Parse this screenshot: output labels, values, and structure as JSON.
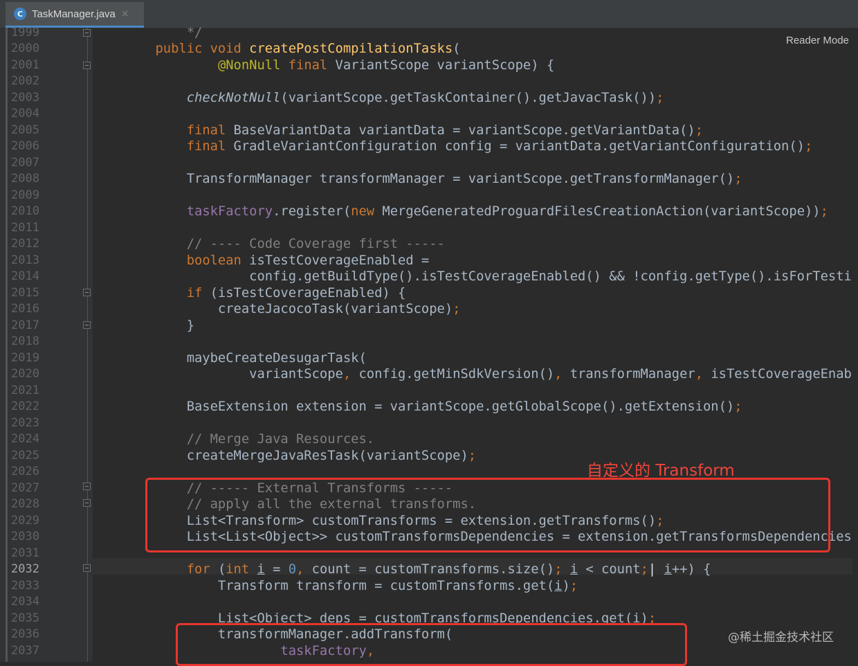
{
  "tab": {
    "filename": "TaskManager.java",
    "file_icon": "java-class-icon",
    "close_glyph": "×"
  },
  "reader_mode": "Reader Mode",
  "current_line": "2032",
  "annotation_label": "自定义的 Transform",
  "watermark": "@稀土掘金技术社区",
  "line_numbers": [
    "1999",
    "2000",
    "2001",
    "2002",
    "2003",
    "2004",
    "2005",
    "2006",
    "2007",
    "2008",
    "2009",
    "2010",
    "2011",
    "2012",
    "2013",
    "2014",
    "2015",
    "2016",
    "2017",
    "2018",
    "2019",
    "2020",
    "2021",
    "2022",
    "2023",
    "2024",
    "2025",
    "2026",
    "2027",
    "2028",
    "2029",
    "2030",
    "2031",
    "2032",
    "2033",
    "2034",
    "2035",
    "2036",
    "2037"
  ],
  "code": {
    "l1999": "    */",
    "l2000": [
      {
        "c": "kw",
        "t": "public void "
      },
      {
        "c": "fn",
        "t": "createPostCompilationTasks"
      },
      {
        "c": "",
        "t": "("
      }
    ],
    "l2001": [
      {
        "c": "",
        "t": "        "
      },
      {
        "c": "an",
        "t": "@NonNull "
      },
      {
        "c": "kw",
        "t": "final "
      },
      {
        "c": "",
        "t": "VariantScope variantScope) {"
      }
    ],
    "l2003": [
      {
        "c": "",
        "t": "    "
      },
      {
        "c": "it",
        "t": "checkNotNull"
      },
      {
        "c": "",
        "t": "(variantScope.getTaskContainer().getJavacTask())"
      },
      {
        "c": "kw",
        "t": ";"
      }
    ],
    "l2005": [
      {
        "c": "",
        "t": "    "
      },
      {
        "c": "kw",
        "t": "final "
      },
      {
        "c": "",
        "t": "BaseVariantData variantData = variantScope.getVariantData()"
      },
      {
        "c": "kw",
        "t": ";"
      }
    ],
    "l2006": [
      {
        "c": "",
        "t": "    "
      },
      {
        "c": "kw",
        "t": "final "
      },
      {
        "c": "",
        "t": "GradleVariantConfiguration config = variantData.getVariantConfiguration()"
      },
      {
        "c": "kw",
        "t": ";"
      }
    ],
    "l2008": [
      {
        "c": "",
        "t": "    TransformManager transformManager = variantScope.getTransformManager()"
      },
      {
        "c": "kw",
        "t": ";"
      }
    ],
    "l2010": [
      {
        "c": "",
        "t": "    "
      },
      {
        "c": "fi",
        "t": "taskFactory"
      },
      {
        "c": "",
        "t": ".register("
      },
      {
        "c": "kw",
        "t": "new "
      },
      {
        "c": "",
        "t": "MergeGeneratedProguardFilesCreationAction(variantScope))"
      },
      {
        "c": "kw",
        "t": ";"
      }
    ],
    "l2012": [
      {
        "c": "",
        "t": "    "
      },
      {
        "c": "cm",
        "t": "// ---- Code Coverage first -----"
      }
    ],
    "l2013": [
      {
        "c": "",
        "t": "    "
      },
      {
        "c": "kw",
        "t": "boolean "
      },
      {
        "c": "",
        "t": "isTestCoverageEnabled ="
      }
    ],
    "l2014": [
      {
        "c": "",
        "t": "            config.getBuildType().isTestCoverageEnabled() && !config.getType().isForTesting()"
      },
      {
        "c": "kw",
        "t": ";"
      }
    ],
    "l2015": [
      {
        "c": "",
        "t": "    "
      },
      {
        "c": "kw",
        "t": "if "
      },
      {
        "c": "",
        "t": "(isTestCoverageEnabled) {"
      }
    ],
    "l2016": [
      {
        "c": "",
        "t": "        createJacocoTask(variantScope)"
      },
      {
        "c": "kw",
        "t": ";"
      }
    ],
    "l2017": [
      {
        "c": "",
        "t": "    }"
      }
    ],
    "l2019": [
      {
        "c": "",
        "t": "    maybeCreateDesugarTask("
      }
    ],
    "l2020": [
      {
        "c": "",
        "t": "            variantScope"
      },
      {
        "c": "kw",
        "t": ", "
      },
      {
        "c": "",
        "t": "config.getMinSdkVersion()"
      },
      {
        "c": "kw",
        "t": ", "
      },
      {
        "c": "",
        "t": "transformManager"
      },
      {
        "c": "kw",
        "t": ", "
      },
      {
        "c": "",
        "t": "isTestCoverageEnabled)"
      },
      {
        "c": "kw",
        "t": ";"
      }
    ],
    "l2022": [
      {
        "c": "",
        "t": "    BaseExtension extension = variantScope.getGlobalScope().getExtension()"
      },
      {
        "c": "kw",
        "t": ";"
      }
    ],
    "l2024": [
      {
        "c": "",
        "t": "    "
      },
      {
        "c": "cm",
        "t": "// Merge Java Resources."
      }
    ],
    "l2025": [
      {
        "c": "",
        "t": "    createMergeJavaResTask(variantScope)"
      },
      {
        "c": "kw",
        "t": ";"
      }
    ],
    "l2027": [
      {
        "c": "",
        "t": "    "
      },
      {
        "c": "cm",
        "t": "// ----- External Transforms -----"
      }
    ],
    "l2028": [
      {
        "c": "",
        "t": "    "
      },
      {
        "c": "cm",
        "t": "// apply all the external transforms."
      }
    ],
    "l2029": [
      {
        "c": "",
        "t": "    List<Transform> customTransforms = extension.getTransforms()"
      },
      {
        "c": "kw",
        "t": ";"
      }
    ],
    "l2030": [
      {
        "c": "",
        "t": "    List<List<Object>> customTransformsDependencies = extension.getTransformsDependencies()"
      },
      {
        "c": "kw",
        "t": ";"
      }
    ],
    "l2032": [
      {
        "c": "",
        "t": "    "
      },
      {
        "c": "kw",
        "t": "for "
      },
      {
        "c": "",
        "t": "("
      },
      {
        "c": "kw",
        "t": "int "
      },
      {
        "c": "ul",
        "t": "i"
      },
      {
        "c": "",
        "t": " = "
      },
      {
        "c": "nm",
        "t": "0"
      },
      {
        "c": "kw",
        "t": ", "
      },
      {
        "c": "",
        "t": "count = customTransforms.size()"
      },
      {
        "c": "kw",
        "t": "; "
      },
      {
        "c": "ul",
        "t": "i"
      },
      {
        "c": "",
        "t": " < count"
      },
      {
        "c": "kw",
        "t": ";"
      },
      {
        "c": "cursor",
        "t": "| "
      },
      {
        "c": "ul",
        "t": "i"
      },
      {
        "c": "",
        "t": "++) {"
      }
    ],
    "l2033": [
      {
        "c": "",
        "t": "        Transform transform = customTransforms.get("
      },
      {
        "c": "ul",
        "t": "i"
      },
      {
        "c": "",
        "t": ")"
      },
      {
        "c": "kw",
        "t": ";"
      }
    ],
    "l2035": [
      {
        "c": "",
        "t": "        List<Object> deps = customTransformsDependencies.get("
      },
      {
        "c": "ul",
        "t": "i"
      },
      {
        "c": "",
        "t": ")"
      },
      {
        "c": "kw",
        "t": ";"
      }
    ],
    "l2036": [
      {
        "c": "",
        "t": "        transformManager.addTransform("
      }
    ],
    "l2037": [
      {
        "c": "",
        "t": "                "
      },
      {
        "c": "fi",
        "t": "taskFactory"
      },
      {
        "c": "kw",
        "t": ","
      }
    ]
  }
}
